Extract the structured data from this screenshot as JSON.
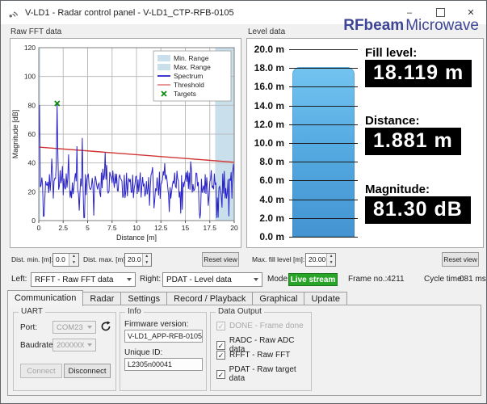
{
  "window": {
    "title": "V-LD1 - Radar control panel - V-LD1_CTP-RFB-0105",
    "minimize": "–",
    "close": "✕"
  },
  "logo": {
    "bold": "RFbeam",
    "light": "Microwave"
  },
  "fft_panel": {
    "group_label": "Raw FFT data"
  },
  "chart_data": {
    "type": "line",
    "title": "Raw FFT data",
    "xlabel": "Distance [m]",
    "ylabel": "Magnitude [dB]",
    "xlim": [
      0,
      20
    ],
    "ylim": [
      0,
      120
    ],
    "xticks": [
      0,
      2.5,
      5,
      7.5,
      10,
      12.5,
      15,
      17.5,
      20
    ],
    "yticks": [
      0,
      20,
      40,
      60,
      80,
      100,
      120
    ],
    "grid": true,
    "legend_position": "top-right",
    "legend": [
      "Min. Range",
      "Max. Range",
      "Spectrum",
      "Threshold",
      "Targets"
    ],
    "regions": [
      {
        "name": "Min. Range",
        "x0": 0,
        "x1": 0.15,
        "color": "#c9e0ec"
      },
      {
        "name": "Max. Range",
        "x0": 18.05,
        "x1": 20,
        "color": "#c9e0ec"
      }
    ],
    "threshold": {
      "color": "#d23434",
      "points": [
        [
          0,
          51
        ],
        [
          20,
          40.5
        ]
      ]
    },
    "targets": {
      "color": "#0f8a0f",
      "points": [
        [
          1.881,
          81.3
        ]
      ]
    },
    "spectrum": {
      "color": "#2a23c8",
      "peaks": [
        [
          0.06,
          84,
          0.06
        ],
        [
          1.881,
          81.3,
          0.07
        ],
        [
          3.05,
          46,
          0.05
        ],
        [
          3.9,
          52,
          0.05
        ],
        [
          4.45,
          57.5,
          0.05
        ],
        [
          6.8,
          47.5,
          0.05
        ]
      ],
      "dips": [
        [
          0.45,
          3
        ],
        [
          4.65,
          2
        ],
        [
          13.35,
          6
        ],
        [
          18.35,
          2
        ],
        [
          19.45,
          3
        ]
      ],
      "noise": {
        "seed": 42,
        "n": 256,
        "floor": 15,
        "span": 20,
        "spike_p": 0.1,
        "spike_amp": 10,
        "dip_p": 0.05
      }
    }
  },
  "level_panel": {
    "group_label": "Level data",
    "scale_ticks": [
      "20.0 m",
      "18.0 m",
      "16.0 m",
      "14.0 m",
      "12.0 m",
      "10.0 m",
      "8.0 m",
      "6.0 m",
      "4.0 m",
      "2.0 m",
      "0.0 m"
    ],
    "gauge": {
      "fill_value": 18.119,
      "max": 20
    },
    "readouts": [
      {
        "label": "Fill level:",
        "value": "18.119 m"
      },
      {
        "label": "Distance:",
        "value": "1.881 m"
      },
      {
        "label": "Magnitude:",
        "value": "81.30 dB"
      }
    ]
  },
  "controls": {
    "dist_min_label": "Dist. min. [m]:",
    "dist_min_value": "0.0",
    "dist_max_label": "Dist. max. [m]:",
    "dist_max_value": "20.0",
    "reset_view_left": "Reset view",
    "max_fill_label": "Max. fill level [m]:",
    "max_fill_value": "20.00",
    "reset_view_right": "Reset view"
  },
  "selector_row": {
    "left_label": "Left:",
    "left_value": "RFFT - Raw FFT data",
    "right_label": "Right:",
    "right_value": "PDAT - Level data",
    "mode_label": "Mode:",
    "mode_value": "Live stream",
    "frame_label": "Frame no.:",
    "frame_value": "4211",
    "cycle_label": "Cycle time:",
    "cycle_value": "081 ms"
  },
  "tabs": [
    {
      "label": "Communication",
      "active": true
    },
    {
      "label": "Radar",
      "active": false
    },
    {
      "label": "Settings",
      "active": false
    },
    {
      "label": "Record / Playback",
      "active": false
    },
    {
      "label": "Graphical",
      "active": false
    },
    {
      "label": "Update",
      "active": false
    }
  ],
  "uart": {
    "group_label": "UART",
    "port_label": "Port:",
    "port_value": "COM23",
    "baud_label": "Baudrate:",
    "baud_value": "2000000",
    "connect_label": "Connect",
    "disconnect_label": "Disconnect"
  },
  "info": {
    "group_label": "Info",
    "fw_label": "Firmware version:",
    "fw_value": "V-LD1_APP-RFB-0105",
    "uid_label": "Unique ID:",
    "uid_value": "L2305n00041"
  },
  "data_output": {
    "group_label": "Data Output",
    "items": [
      {
        "label": "DONE - Frame done",
        "checked": true,
        "disabled": true
      },
      {
        "label": "RADC - Raw ADC data",
        "checked": true,
        "disabled": false
      },
      {
        "label": "RFFT - Raw FFT",
        "checked": true,
        "disabled": false
      },
      {
        "label": "PDAT - Raw target data",
        "checked": true,
        "disabled": false
      }
    ]
  },
  "colors": {
    "spectrum": "#2a23c8",
    "threshold": "#d23434",
    "range_band": "#c9e0ec",
    "target": "#0f8a0f",
    "mode_badge_bg": "#28a428",
    "mode_badge_border": "#1b7a1b",
    "readout_bg": "#000000",
    "readout_fg": "#ffffff",
    "logo": "#3e4594"
  }
}
